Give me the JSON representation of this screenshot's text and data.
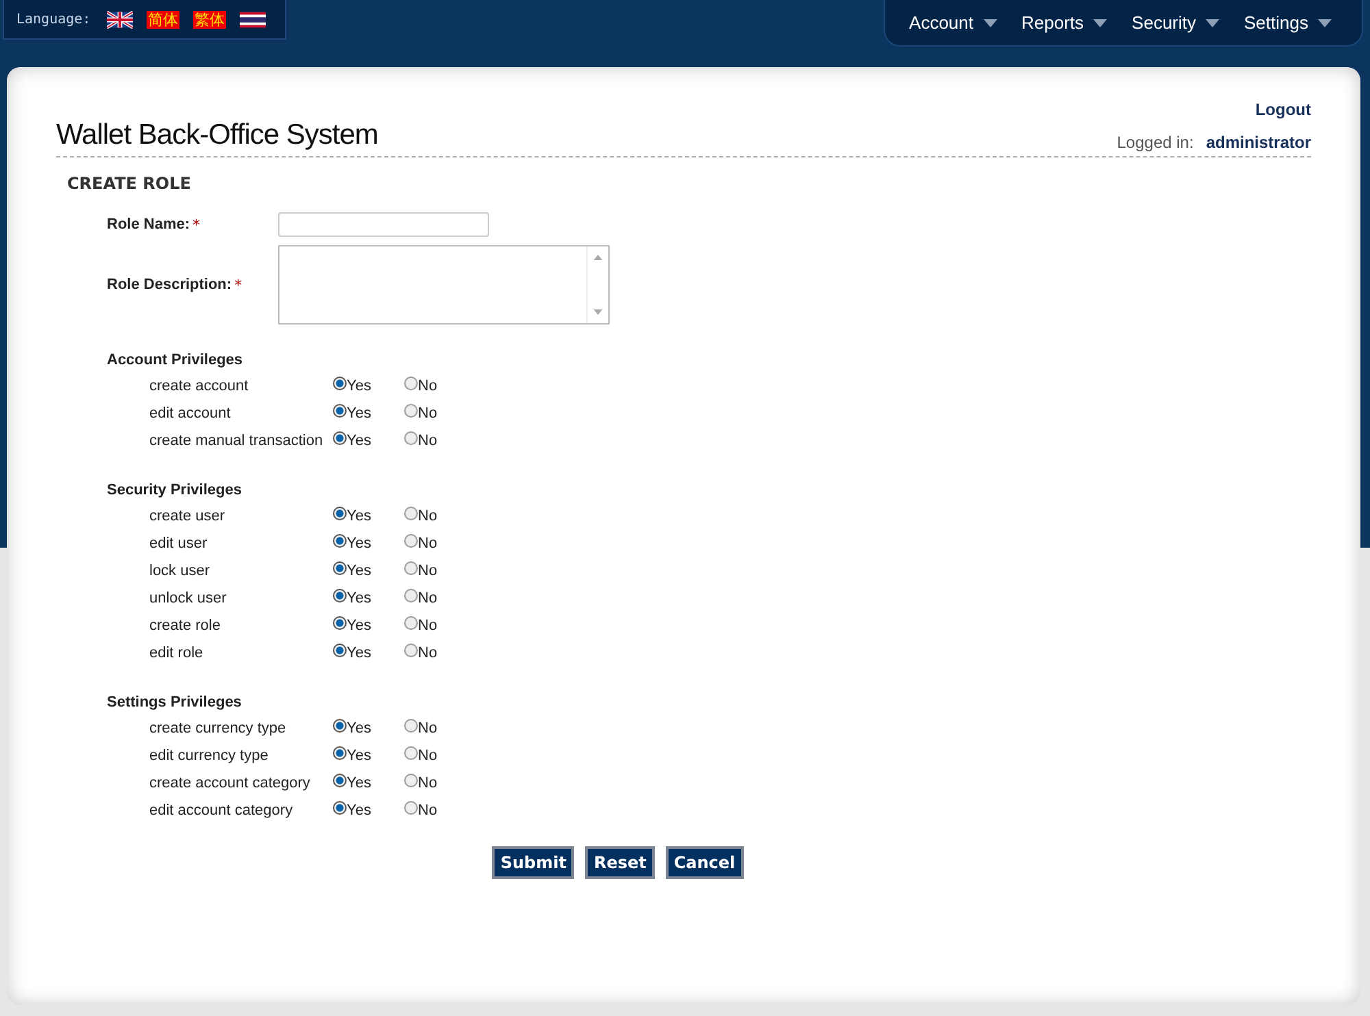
{
  "language": {
    "label": "Language:",
    "options": [
      {
        "kind": "flag-uk"
      },
      {
        "kind": "text",
        "label": "简体"
      },
      {
        "kind": "text",
        "label": "繁体"
      },
      {
        "kind": "flag-thai"
      }
    ]
  },
  "nav": [
    {
      "label": "Account"
    },
    {
      "label": "Reports"
    },
    {
      "label": "Security"
    },
    {
      "label": "Settings"
    }
  ],
  "logout": "Logout",
  "app_title": "Wallet Back-Office System",
  "logged_in": {
    "label": "Logged in:",
    "user": "administrator"
  },
  "form": {
    "title": "CREATE ROLE",
    "fields": [
      {
        "kind": "input",
        "label": "Role Name:",
        "required_mark": "*"
      },
      {
        "kind": "textarea",
        "label": "Role Description:",
        "required_mark": "*"
      }
    ],
    "sections": [
      {
        "title": "Account Privileges",
        "rows": [
          {
            "label": "create account",
            "options": [
              {
                "label": "Yes",
                "selected": true
              },
              {
                "label": "No",
                "selected": false
              }
            ]
          },
          {
            "label": "edit account",
            "options": [
              {
                "label": "Yes",
                "selected": true
              },
              {
                "label": "No",
                "selected": false
              }
            ]
          },
          {
            "label": "create manual transaction",
            "options": [
              {
                "label": "Yes",
                "selected": true
              },
              {
                "label": "No",
                "selected": false
              }
            ]
          }
        ]
      },
      {
        "title": "Security Privileges",
        "rows": [
          {
            "label": "create user",
            "options": [
              {
                "label": "Yes",
                "selected": true
              },
              {
                "label": "No",
                "selected": false
              }
            ]
          },
          {
            "label": "edit user",
            "options": [
              {
                "label": "Yes",
                "selected": true
              },
              {
                "label": "No",
                "selected": false
              }
            ]
          },
          {
            "label": "lock user",
            "options": [
              {
                "label": "Yes",
                "selected": true
              },
              {
                "label": "No",
                "selected": false
              }
            ]
          },
          {
            "label": "unlock user",
            "options": [
              {
                "label": "Yes",
                "selected": true
              },
              {
                "label": "No",
                "selected": false
              }
            ]
          },
          {
            "label": "create role",
            "options": [
              {
                "label": "Yes",
                "selected": true
              },
              {
                "label": "No",
                "selected": false
              }
            ]
          },
          {
            "label": "edit role",
            "options": [
              {
                "label": "Yes",
                "selected": true
              },
              {
                "label": "No",
                "selected": false
              }
            ]
          }
        ]
      },
      {
        "title": "Settings Privileges",
        "rows": [
          {
            "label": "create currency type",
            "options": [
              {
                "label": "Yes",
                "selected": true
              },
              {
                "label": "No",
                "selected": false
              }
            ]
          },
          {
            "label": "edit currency type",
            "options": [
              {
                "label": "Yes",
                "selected": true
              },
              {
                "label": "No",
                "selected": false
              }
            ]
          },
          {
            "label": "create account category",
            "options": [
              {
                "label": "Yes",
                "selected": true
              },
              {
                "label": "No",
                "selected": false
              }
            ]
          },
          {
            "label": "edit account category",
            "options": [
              {
                "label": "Yes",
                "selected": true
              },
              {
                "label": "No",
                "selected": false
              }
            ]
          }
        ]
      }
    ],
    "buttons": [
      {
        "label": "Submit"
      },
      {
        "label": "Reset"
      },
      {
        "label": "Cancel"
      }
    ]
  }
}
